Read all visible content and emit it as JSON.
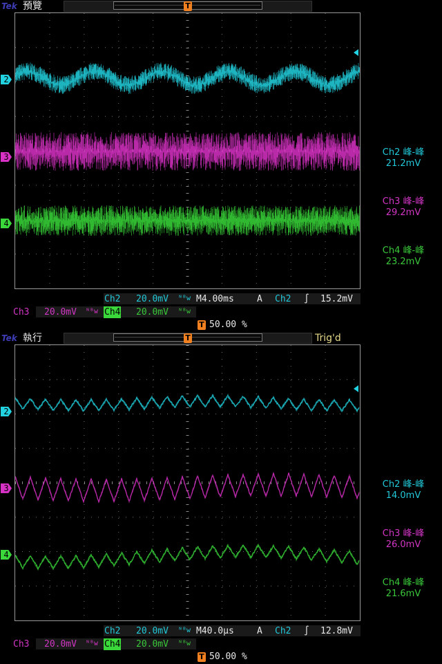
{
  "panels": [
    {
      "logo": "Tek",
      "mode": "預覽",
      "status": "",
      "trigger_marker": "T",
      "channels": [
        {
          "id": "2",
          "color": "#22d2e0"
        },
        {
          "id": "3",
          "color": "#d831c6"
        },
        {
          "id": "4",
          "color": "#3ad83a"
        }
      ],
      "measurements": [
        {
          "label": "Ch2 峰-峰",
          "value": "21.2mV"
        },
        {
          "label": "Ch3 峰-峰",
          "value": "29.2mV"
        },
        {
          "label": "Ch4 峰-峰",
          "value": "23.2mV"
        }
      ],
      "readout": {
        "ch2": "Ch2",
        "ch2_scale": "20.0mV",
        "timebase": "M4.00ms",
        "trig_mode": "A",
        "trig_src": "Ch2",
        "trig_slope": "∫",
        "trig_level": "15.2mV",
        "ch3": "Ch3",
        "ch3_scale": "20.0mV",
        "ch4": "Ch4",
        "ch4_scale": "20.0mV",
        "bw": "ᴺᴮw",
        "pos_marker": "T",
        "position": "50.00 %"
      }
    },
    {
      "logo": "Tek",
      "mode": "執行",
      "status": "Trig'd",
      "trigger_marker": "T",
      "channels": [
        {
          "id": "2",
          "color": "#22d2e0"
        },
        {
          "id": "3",
          "color": "#d831c6"
        },
        {
          "id": "4",
          "color": "#3ad83a"
        }
      ],
      "measurements": [
        {
          "label": "Ch2 峰-峰",
          "value": "14.0mV"
        },
        {
          "label": "Ch3 峰-峰",
          "value": "26.0mV"
        },
        {
          "label": "Ch4 峰-峰",
          "value": "21.6mV"
        }
      ],
      "readout": {
        "ch2": "Ch2",
        "ch2_scale": "20.0mV",
        "timebase": "M40.0µs",
        "trig_mode": "A",
        "trig_src": "Ch2",
        "trig_slope": "∫",
        "trig_level": "12.8mV",
        "ch3": "Ch3",
        "ch3_scale": "20.0mV",
        "ch4": "Ch4",
        "ch4_scale": "20.0mV",
        "bw": "ᴺᴮw",
        "pos_marker": "T",
        "position": "50.00 %"
      }
    }
  ]
}
